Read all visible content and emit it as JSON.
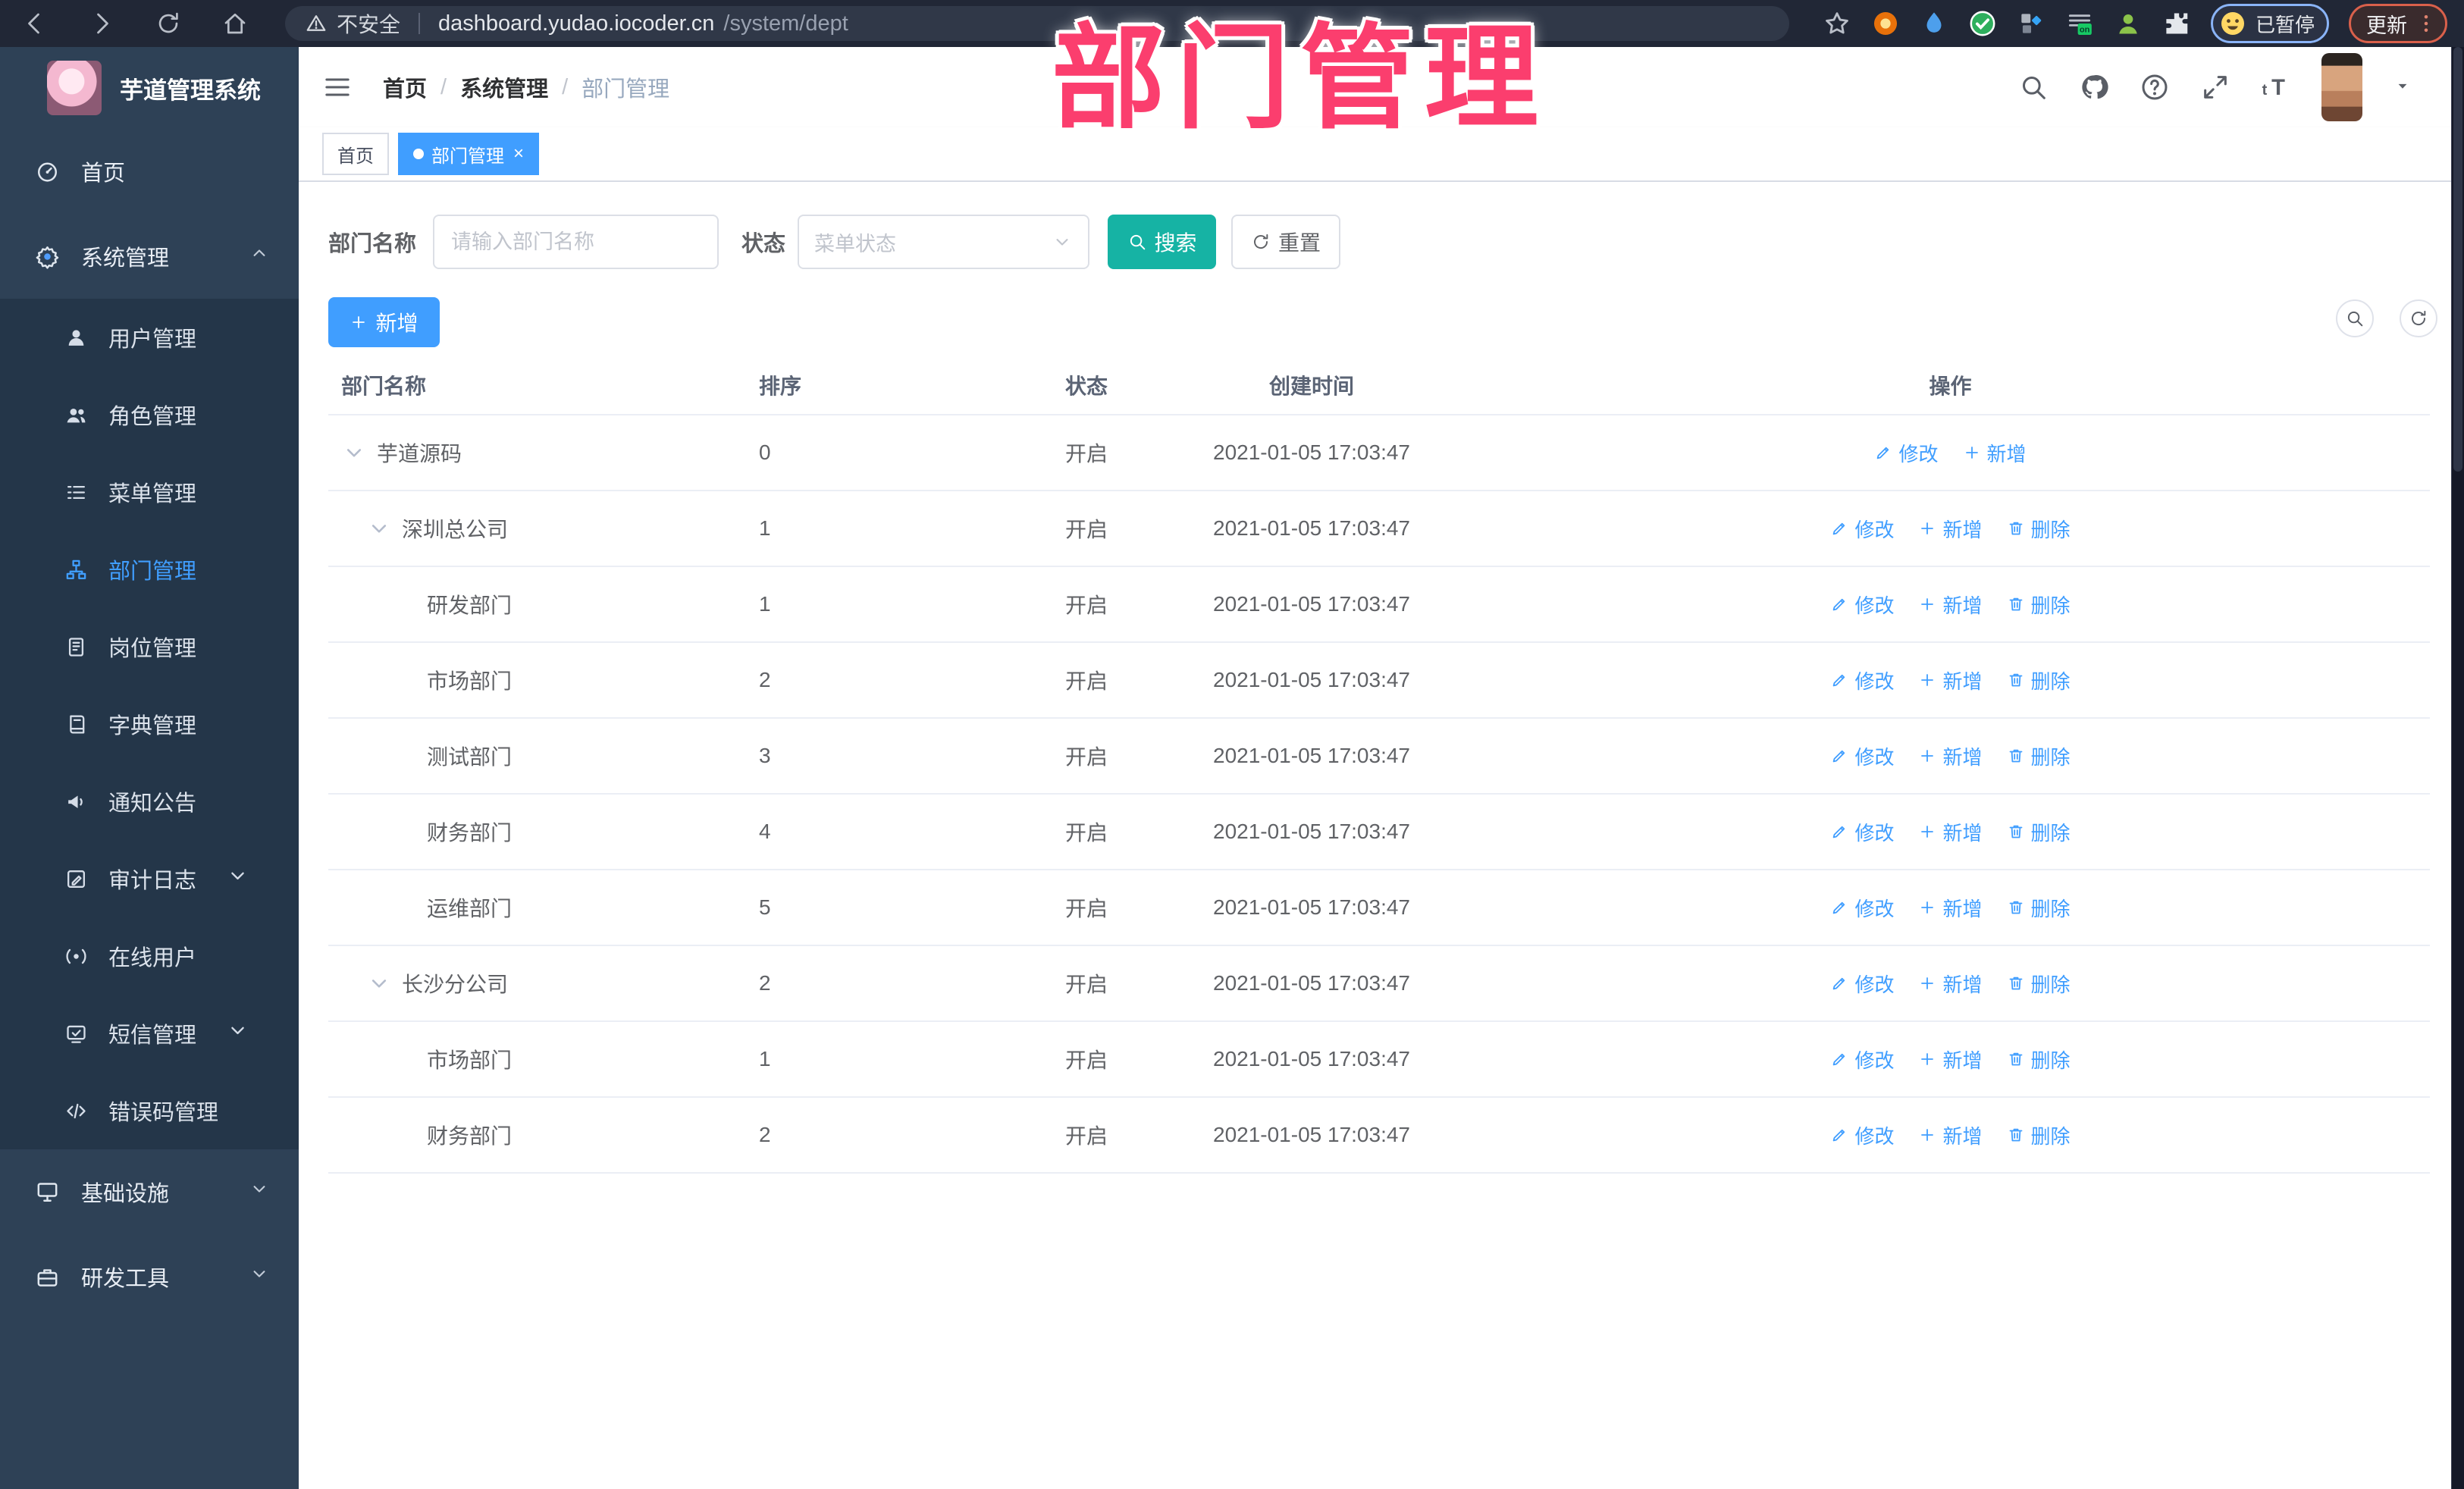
{
  "annotation": {
    "text": "部门管理"
  },
  "browser": {
    "security_label": "不安全",
    "url_host": "dashboard.yudao.iocoder.cn",
    "url_path": "/system/dept",
    "profile_badge": "已暂停",
    "update_label": "更新",
    "nav_icons": [
      "back-icon",
      "forward-icon",
      "reload-icon",
      "home-icon"
    ],
    "extension_icons": [
      "extension-orange-icon",
      "extension-drop-icon",
      "extension-check-icon",
      "extension-puzzle-blue-icon",
      "extension-list-on-icon",
      "extension-person-icon",
      "extensions-puzzle-icon"
    ]
  },
  "sidebar": {
    "logo_title": "芋道管理系统",
    "items": [
      {
        "label": "首页",
        "icon": "dashboard-icon",
        "level": "root"
      },
      {
        "label": "系统管理",
        "icon": "gear-icon",
        "level": "root",
        "chevron": "up"
      },
      {
        "label": "用户管理",
        "icon": "user-icon",
        "level": "sub"
      },
      {
        "label": "角色管理",
        "icon": "users-icon",
        "level": "sub"
      },
      {
        "label": "菜单管理",
        "icon": "menu-list-icon",
        "level": "sub"
      },
      {
        "label": "部门管理",
        "icon": "org-tree-icon",
        "level": "sub",
        "active": true
      },
      {
        "label": "岗位管理",
        "icon": "badge-icon",
        "level": "sub"
      },
      {
        "label": "字典管理",
        "icon": "dictionary-icon",
        "level": "sub"
      },
      {
        "label": "通知公告",
        "icon": "megaphone-icon",
        "level": "sub"
      },
      {
        "label": "审计日志",
        "icon": "audit-log-icon",
        "level": "sub",
        "chevron": "down"
      },
      {
        "label": "在线用户",
        "icon": "online-users-icon",
        "level": "sub"
      },
      {
        "label": "短信管理",
        "icon": "sms-icon",
        "level": "sub",
        "chevron": "down"
      },
      {
        "label": "错误码管理",
        "icon": "error-code-icon",
        "level": "sub"
      },
      {
        "label": "基础设施",
        "icon": "infrastructure-icon",
        "level": "root",
        "chevron": "down"
      },
      {
        "label": "研发工具",
        "icon": "devtools-icon",
        "level": "root",
        "chevron": "down"
      }
    ]
  },
  "header": {
    "breadcrumb": [
      "首页",
      "系统管理",
      "部门管理"
    ],
    "tool_icons": [
      "search-icon",
      "github-icon",
      "help-icon",
      "fullscreen-icon",
      "font-size-icon"
    ]
  },
  "tabs": [
    {
      "label": "首页",
      "active": false,
      "closable": false
    },
    {
      "label": "部门管理",
      "active": true,
      "closable": true
    }
  ],
  "filters": {
    "name_label": "部门名称",
    "name_placeholder": "请输入部门名称",
    "status_label": "状态",
    "status_placeholder": "菜单状态",
    "search_label": "搜索",
    "reset_label": "重置"
  },
  "toolbar": {
    "add_label": "新增"
  },
  "table": {
    "columns": [
      "部门名称",
      "排序",
      "状态",
      "创建时间",
      "操作"
    ],
    "action_labels": {
      "edit": "修改",
      "add": "新增",
      "delete": "删除"
    },
    "rows": [
      {
        "name": "芋道源码",
        "level": 0,
        "expandable": true,
        "sort": "0",
        "status": "开启",
        "created": "2021-01-05 17:03:47",
        "actions": [
          "edit",
          "add"
        ]
      },
      {
        "name": "深圳总公司",
        "level": 1,
        "expandable": true,
        "sort": "1",
        "status": "开启",
        "created": "2021-01-05 17:03:47",
        "actions": [
          "edit",
          "add",
          "delete"
        ]
      },
      {
        "name": "研发部门",
        "level": 2,
        "expandable": false,
        "sort": "1",
        "status": "开启",
        "created": "2021-01-05 17:03:47",
        "actions": [
          "edit",
          "add",
          "delete"
        ]
      },
      {
        "name": "市场部门",
        "level": 2,
        "expandable": false,
        "sort": "2",
        "status": "开启",
        "created": "2021-01-05 17:03:47",
        "actions": [
          "edit",
          "add",
          "delete"
        ]
      },
      {
        "name": "测试部门",
        "level": 2,
        "expandable": false,
        "sort": "3",
        "status": "开启",
        "created": "2021-01-05 17:03:47",
        "actions": [
          "edit",
          "add",
          "delete"
        ]
      },
      {
        "name": "财务部门",
        "level": 2,
        "expandable": false,
        "sort": "4",
        "status": "开启",
        "created": "2021-01-05 17:03:47",
        "actions": [
          "edit",
          "add",
          "delete"
        ]
      },
      {
        "name": "运维部门",
        "level": 2,
        "expandable": false,
        "sort": "5",
        "status": "开启",
        "created": "2021-01-05 17:03:47",
        "actions": [
          "edit",
          "add",
          "delete"
        ]
      },
      {
        "name": "长沙分公司",
        "level": 1,
        "expandable": true,
        "sort": "2",
        "status": "开启",
        "created": "2021-01-05 17:03:47",
        "actions": [
          "edit",
          "add",
          "delete"
        ]
      },
      {
        "name": "市场部门",
        "level": 2,
        "expandable": false,
        "sort": "1",
        "status": "开启",
        "created": "2021-01-05 17:03:47",
        "actions": [
          "edit",
          "add",
          "delete"
        ]
      },
      {
        "name": "财务部门",
        "level": 2,
        "expandable": false,
        "sort": "2",
        "status": "开启",
        "created": "2021-01-05 17:03:47",
        "actions": [
          "edit",
          "add",
          "delete"
        ]
      }
    ]
  },
  "colors": {
    "primary": "#409EFF",
    "teal": "#16b3a4",
    "annotation_pink": "#fb3e6e",
    "sidebar_bg": "#2e4156"
  }
}
